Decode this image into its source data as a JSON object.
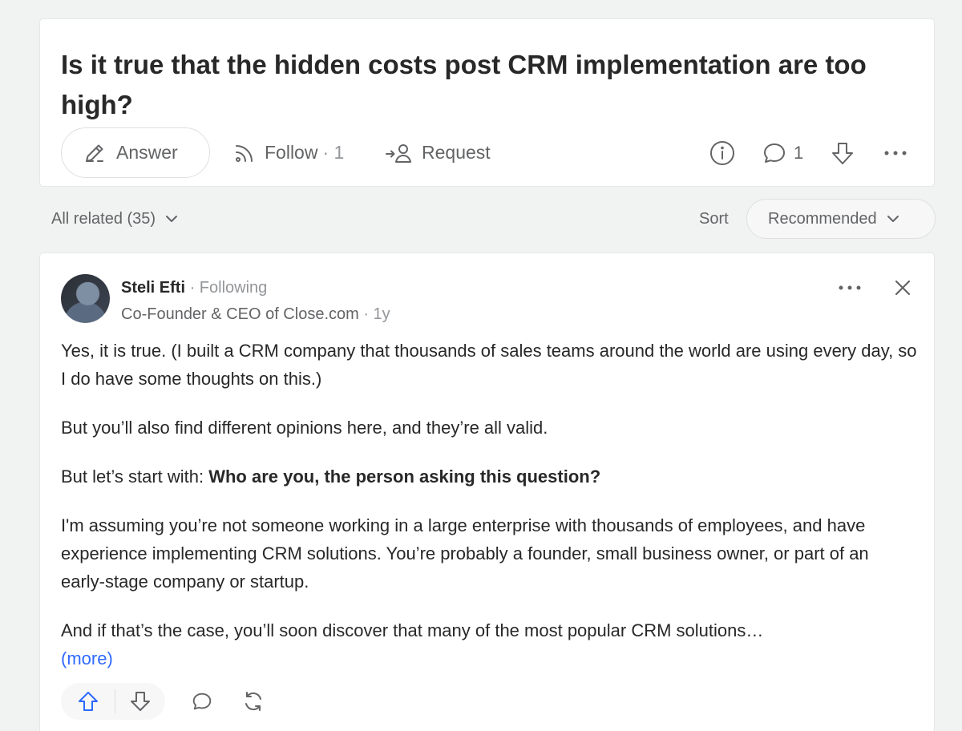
{
  "question": {
    "title": "Is it true that the hidden costs post CRM implementation are too high?",
    "actions": {
      "answer_label": "Answer",
      "follow_label": "Follow",
      "follow_count": "· 1",
      "request_label": "Request",
      "comment_count": "1"
    }
  },
  "related": {
    "all_related_label": "All related (35)",
    "sort_label": "Sort",
    "sort_value": "Recommended"
  },
  "answer": {
    "author_name": "Steli Efti",
    "follow_status": " · Following",
    "credential": "Co-Founder & CEO of Close.com",
    "age": " · 1y",
    "paragraphs": {
      "p1": "Yes, it is true. (I built a CRM company that thousands of sales teams around the world are using every day, so I do have some thoughts on this.)",
      "p2": "But you’ll also find different opinions here, and they’re all valid.",
      "p3_prefix": "But let’s start with: ",
      "p3_bold": "Who are you, the person asking this question?",
      "p4": "I'm assuming you’re not someone working in a large enterprise with thousands of employees, and have experience implementing CRM solutions. You’re probably a founder, small business owner, or part of an early-stage company or startup.",
      "p5": "And if that’s the case, you’ll soon discover that many of the most popular CRM solutions…"
    },
    "more_label": "(more)"
  },
  "icons": {
    "answer": "pencil-icon",
    "follow": "rss-icon",
    "request": "request-user-icon",
    "info": "info-icon",
    "comment": "comment-icon",
    "downvote": "downvote-icon",
    "more": "more-horizontal-icon",
    "close": "close-icon",
    "upvote": "upvote-icon",
    "share": "share-icon"
  },
  "colors": {
    "accent": "#2e69ff",
    "text": "#282829",
    "muted": "#636466",
    "background": "#f1f2f2"
  }
}
